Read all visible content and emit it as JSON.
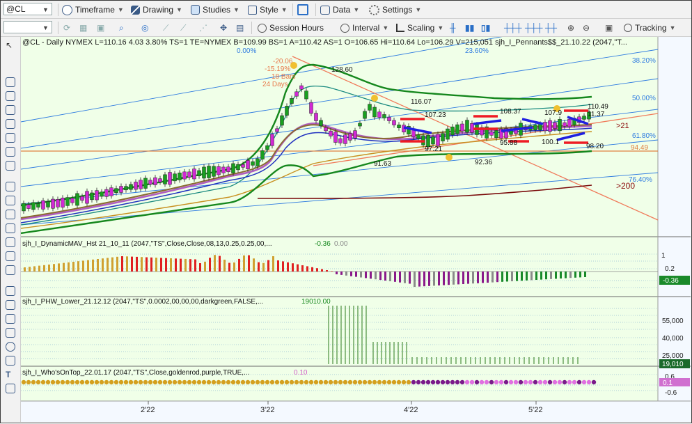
{
  "toolbar": {
    "symbol": "@CL",
    "timeframe": "Timeframe",
    "drawing": "Drawing",
    "studies": "Studies",
    "style": "Style",
    "data": "Data",
    "settings": "Settings",
    "session_hours": "Session Hours",
    "interval": "Interval",
    "scaling": "Scaling",
    "tracking": "Tracking"
  },
  "header": "@CL - Daily  NYMEX  L=110.16  4.03  3.80%  TS=1  TE=NYMEX  B=109.99  BS=1  A=110.42  AS=1  O=106.65  Hi=110.64  Lo=106.29  V=215,051  sjh_I_Pennants$$_21.10.22 (2047,\"T...",
  "fib_labels": [
    "0.00%",
    "23.60%",
    "38.20%",
    "50.00%",
    "61.80%",
    "76.40%"
  ],
  "swing_labels": [
    "-20.06",
    "-15.19%",
    "18 Bars",
    "24 Days"
  ],
  "price_labels": [
    "128.60",
    "116.07",
    "107.23",
    "108.37",
    "107.9",
    "110.49",
    "11.37",
    "97.21",
    "95.88",
    "100.1",
    "98.20",
    "91.63",
    "92.36",
    ">21",
    "94.49",
    ">200"
  ],
  "panels": {
    "dmav": {
      "title": "sjh_I_DynamicMAV_Hst 21_10_11 (2047,\"TS\",Close,Close,08,13,0.25,0.25,00,...",
      "v1": "-0.36",
      "v2": "0.00"
    },
    "phw": {
      "title": "sjh_I_PHW_Lower_21.12.12 (2047,\"TS\",0.0002,00,00,00,darkgreen,FALSE,...",
      "v1": "19010.00"
    },
    "who": {
      "title": "sjh_I_Who'sOnTop_22.01.17 (2047,\"TS\",Close,goldenrod,purple,TRUE,...",
      "v1": "0.10"
    }
  },
  "axes": {
    "dmav": [
      "1",
      "0.2",
      "-0.36"
    ],
    "phw": [
      "55,000",
      "40,000",
      "25,000",
      "19,010"
    ],
    "who": [
      "0.6",
      "0.1",
      "-0.6"
    ],
    "x": [
      "2'22",
      "3'22",
      "4'22",
      "5'22"
    ]
  },
  "colors": {
    "bg": "#f0ffe8",
    "accent_blue": "#2050c8",
    "toolbar": "#f2f2f2"
  }
}
